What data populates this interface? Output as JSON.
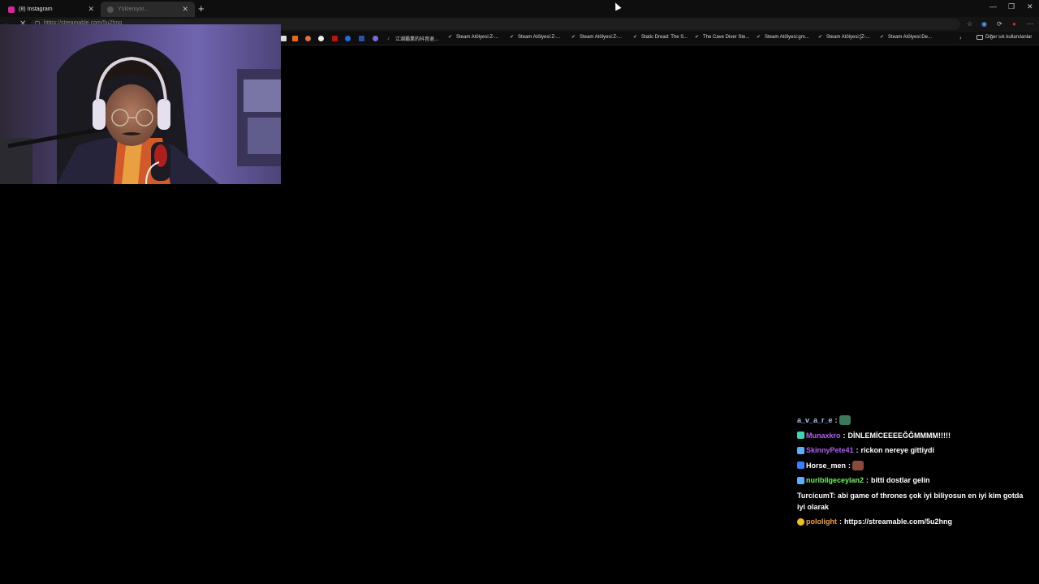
{
  "tabs": [
    {
      "title": "(8) Instagram",
      "active": true,
      "favicon_color": "#d6249f"
    },
    {
      "title": "Yükleniyor...",
      "active": false,
      "favicon_color": "#888888"
    }
  ],
  "address_bar": {
    "url": "https://streamable.com/5u2hng"
  },
  "bookmarks": [
    {
      "label": "江湖霸業的抖音退...",
      "icon": "tiktok-icon"
    },
    {
      "label": "Steam Atölyesi:Z-...",
      "icon": "steam-icon"
    },
    {
      "label": "Steam Atölyesi:Z-...",
      "icon": "steam-icon"
    },
    {
      "label": "Steam Atölyesi:Z-...",
      "icon": "steam-icon"
    },
    {
      "label": "Static Dread: The S...",
      "icon": "steam-icon"
    },
    {
      "label": "The Cave Diver Ste...",
      "icon": "steam-icon"
    },
    {
      "label": "Steam Atölyesi:gm...",
      "icon": "steam-icon"
    },
    {
      "label": "Steam Atölyesi:[Z-...",
      "icon": "steam-icon"
    },
    {
      "label": "Steam Atölyesi:De...",
      "icon": "steam-icon"
    }
  ],
  "other_bookmarks": "Diğer sık kullanılanlar",
  "chat": [
    {
      "user": "a_v_a_r_e",
      "color": "#a9c4e8",
      "text": "",
      "badge": null,
      "emote": "#3a7a5a"
    },
    {
      "user": "Munaxkro",
      "color": "#b15cf0",
      "text": "DİNLEMİCEEEEĞĞMMMM!!!!!",
      "badge": "#3fd3b3",
      "emote": null
    },
    {
      "user": "SkinnyPete41",
      "color": "#b15cf0",
      "text": "rickon nereye gittiydi",
      "badge": "#5ab0ff",
      "emote": null
    },
    {
      "user": "Horse_men",
      "color": "#ffffff",
      "text": "",
      "badge": "#3a7fff",
      "emote": "#8a4a3a"
    },
    {
      "user": "nuribilgeceylan2",
      "color": "#6ef05a",
      "text": "bitti dostlar gelin",
      "badge": "#5ab0ff",
      "emote": null
    },
    {
      "user": "TurcicumT",
      "color": "#ffffff",
      "text": "abi game of thrones çok iyi biliyosun en iyi kim gotda iyi olarak",
      "badge": null,
      "emote": null
    },
    {
      "user": "pololight",
      "color": "#f0a030",
      "text": "https://streamable.com/5u2hng",
      "badge": "#f0c020",
      "emote": null
    }
  ]
}
